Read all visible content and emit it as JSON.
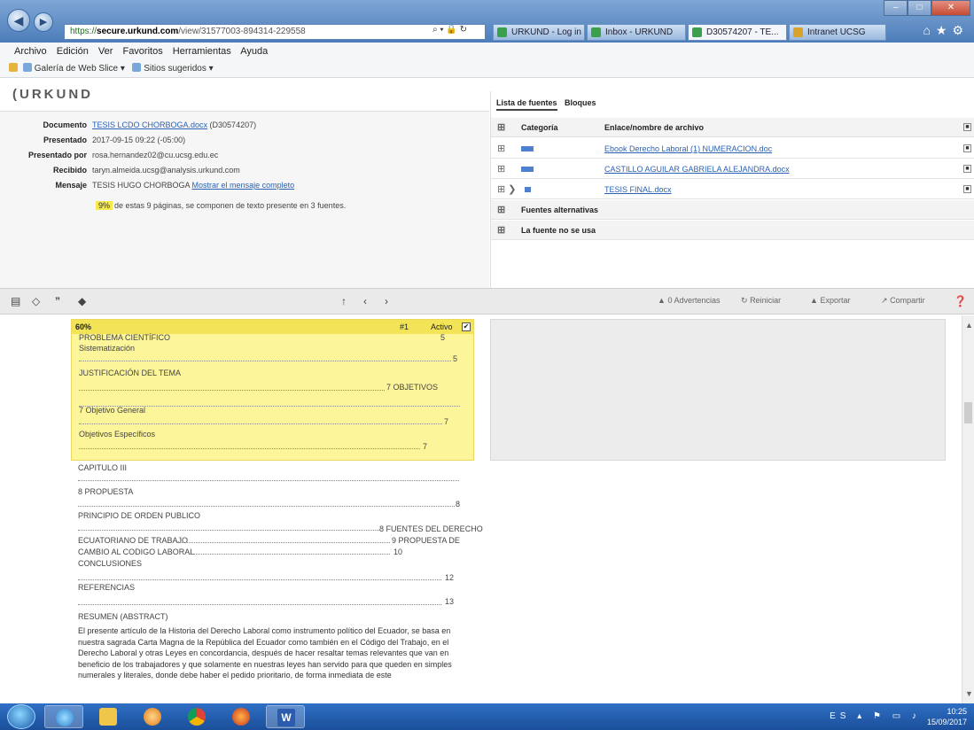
{
  "browser": {
    "address": {
      "scheme": "https://",
      "host": "secure.urkund.com",
      "path": "/view/31577003-894314-229558"
    },
    "tabs": [
      "URKUND - Log in",
      "Inbox - URKUND",
      "D30574207 - TE...",
      "Intranet UCSG"
    ],
    "active_tab": 2,
    "menu": [
      "Archivo",
      "Edición",
      "Ver",
      "Favoritos",
      "Herramientas",
      "Ayuda"
    ],
    "favorites": [
      "Galería de Web Slice",
      "Sitios sugeridos"
    ]
  },
  "urkund": {
    "logo": "URKUND",
    "info": {
      "documento_label": "Documento",
      "documento_link": "TESIS LCDO CHORBOGA.docx",
      "documento_id": "(D30574207)",
      "presentado_label": "Presentado",
      "presentado": "2017-09-15 09:22 (-05:00)",
      "presentado_por_label": "Presentado por",
      "presentado_por": "rosa.hernandez02@cu.ucsg.edu.ec",
      "recibido_label": "Recibido",
      "recibido": "taryn.almeida.ucsg@analysis.urkund.com",
      "mensaje_label": "Mensaje",
      "mensaje": "TESIS HUGO CHORBOGA",
      "mensaje_link": "Mostrar el mensaje completo",
      "summary_pct": "9%",
      "summary_text": "de estas 9 páginas, se componen de texto presente en 3 fuentes."
    },
    "sources": {
      "tabs": [
        "Lista de fuentes",
        "Bloques"
      ],
      "headers": [
        "Categoría",
        "Enlace/nombre de archivo"
      ],
      "rows": [
        "Ebook Derecho Laboral (1) NUMERACION.doc",
        "CASTILLO AGUILAR GABRIELA ALEJANDRA.docx",
        "TESIS FINAL.docx"
      ],
      "groups": [
        "Fuentes alternativas",
        "La fuente no se usa"
      ]
    },
    "toolbar": {
      "advertencias": "0 Advertencias",
      "reiniciar": "Reiniciar",
      "exportar": "Exportar",
      "compartir": "Compartir"
    },
    "highlight": {
      "percent": "60%",
      "num": "#1",
      "active_label": "Activo"
    },
    "doc_lines": {
      "l0": "PROBLEMA CIENTÍFICO",
      "l0n": "5",
      "l1": "Sistematización",
      "l1n": "5",
      "l2": "JUSTIFICACIÓN DEL TEMA",
      "l2b": "7 OBJETIVOS",
      "l3": "7 Objetivo General",
      "l3n": "7",
      "l4": "Objetivos Específicos",
      "l4n": "7",
      "l5": "CAPITULO III",
      "l6": "8 PROPUESTA",
      "l6n": "8",
      "l7": "PRINCIPIO DE ORDEN PUBLICO",
      "l7b": "8 FUENTES DEL DERECHO",
      "l8": "ECUATORIANO DE TRABAJO",
      "l8b": "9 PROPUESTA DE",
      "l9": "CAMBIO AL CODIGO LABORAL",
      "l9n": "10",
      "l10": "CONCLUSIONES",
      "l10n": "12",
      "l11": "REFERENCIAS",
      "l11n": "13",
      "l12": "RESUMEN (ABSTRACT)"
    },
    "abstract": "El presente artículo de la Historia del Derecho Laboral como instrumento político del Ecuador, se basa en nuestra sagrada Carta Magna de la República del Ecuador como también en el Código del Trabajo, en el Derecho Laboral y otras Leyes en concordancia, después de hacer resaltar temas relevantes que van en beneficio de los trabajadores y que solamente en nuestras leyes han servido para que queden en simples numerales y literales, donde debe haber el pedido prioritario, de forma inmediata de este"
  },
  "taskbar": {
    "lang": "ES",
    "time": "10:25",
    "date": "15/09/2017"
  }
}
